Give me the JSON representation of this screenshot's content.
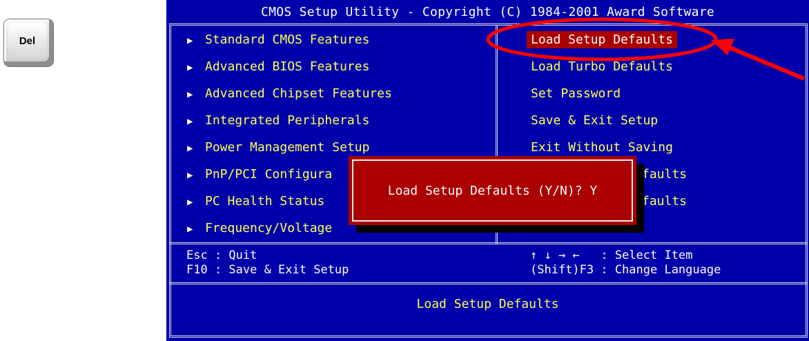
{
  "del_key": {
    "label": "Del"
  },
  "bios": {
    "title": "CMOS Setup Utility - Copyright (C) 1984-2001 Award Software",
    "left_menu": [
      {
        "label": "Standard CMOS Features"
      },
      {
        "label": "Advanced BIOS Features"
      },
      {
        "label": "Advanced Chipset Features"
      },
      {
        "label": "Integrated Peripherals"
      },
      {
        "label": "Power Management Setup"
      },
      {
        "label": "PnP/PCI Configura"
      },
      {
        "label": "PC Health Status"
      },
      {
        "label": "Frequency/Voltage"
      }
    ],
    "right_menu": [
      {
        "label": "Load Setup Defaults",
        "selected": true
      },
      {
        "label": "Load Turbo Defaults"
      },
      {
        "label": "Set Password"
      },
      {
        "label": "Save & Exit Setup"
      },
      {
        "label": "Exit Without Saving"
      },
      {
        "label": "faults"
      },
      {
        "label": "faults"
      }
    ],
    "status": {
      "line1_left": "Esc : Quit",
      "line2_left": "F10 : Save & Exit Setup",
      "line1_right": "↑ ↓ → ←   : Select Item",
      "line2_right": "(Shift)F3 : Change Language"
    },
    "help_text": "Load Setup Defaults",
    "dialog": {
      "prompt": "Load Setup Defaults (Y/N)? Y"
    }
  },
  "colors": {
    "bios_background": "#0000aa",
    "menu_text": "#ffff55",
    "highlight": "#aa0000",
    "annotation": "#ff0000"
  },
  "icons": [
    "menu-arrow-icon",
    "annotation-circle",
    "annotation-arrow"
  ]
}
